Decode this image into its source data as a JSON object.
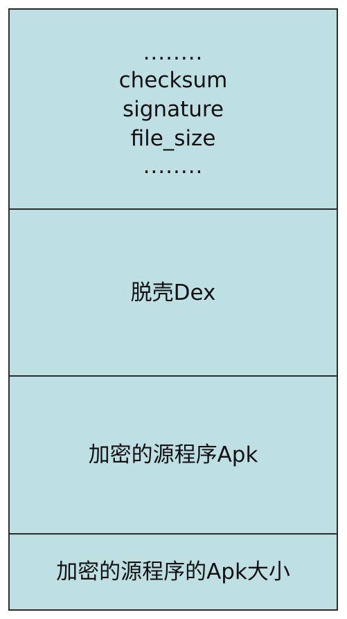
{
  "diagram": {
    "header_section": {
      "lines": [
        "........",
        "checksum",
        "signature",
        "file_size",
        "........"
      ]
    },
    "shell_dex": {
      "label": "脱壳Dex"
    },
    "encrypted_apk": {
      "label": "加密的源程序Apk"
    },
    "apk_size": {
      "label": "加密的源程序的Apk大小"
    }
  }
}
